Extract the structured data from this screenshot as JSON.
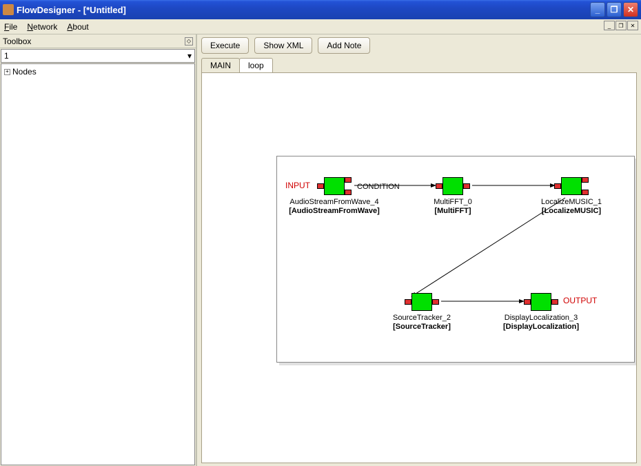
{
  "window": {
    "title": "FlowDesigner - [*Untitled]"
  },
  "menu": {
    "file": "File",
    "network": "Network",
    "about": "About"
  },
  "sidebar": {
    "title": "Toolbox",
    "combo_value": "1",
    "tree_root": "Nodes"
  },
  "toolbar": {
    "execute": "Execute",
    "show_xml": "Show XML",
    "add_note": "Add Note"
  },
  "tabs": {
    "main": "MAIN",
    "loop": "loop"
  },
  "io": {
    "input": "INPUT",
    "output": "OUTPUT",
    "condition": "CONDITION"
  },
  "nodes": {
    "audio": {
      "name": "AudioStreamFromWave_4",
      "type": "[AudioStreamFromWave]"
    },
    "fft": {
      "name": "MultiFFT_0",
      "type": "[MultiFFT]"
    },
    "loc": {
      "name": "LocalizeMUSIC_1",
      "type": "[LocalizeMUSIC]"
    },
    "tracker": {
      "name": "SourceTracker_2",
      "type": "[SourceTracker]"
    },
    "display": {
      "name": "DisplayLocalization_3",
      "type": "[DisplayLocalization]"
    }
  }
}
